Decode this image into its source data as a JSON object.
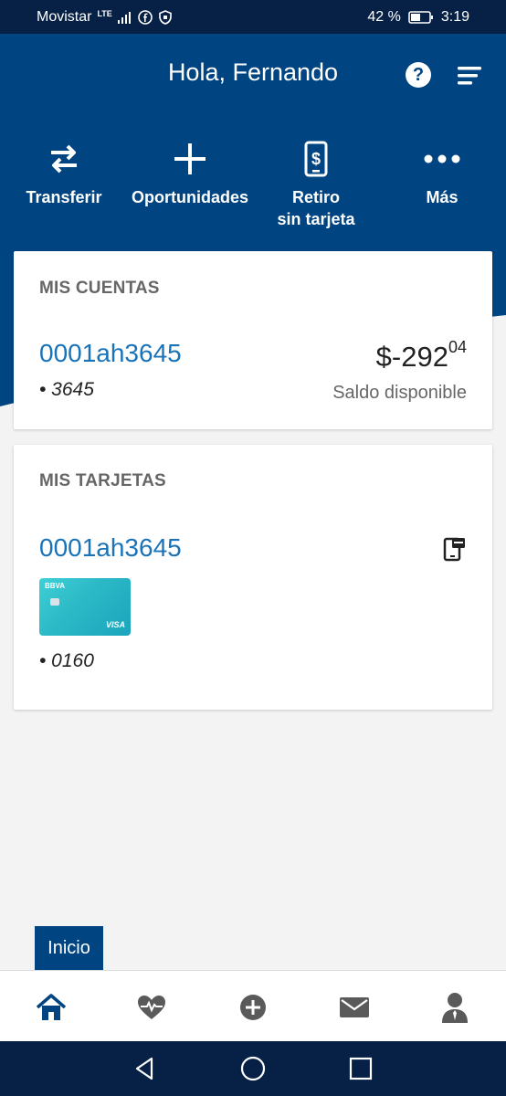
{
  "status_bar": {
    "carrier": "Movistar",
    "network": "LTE",
    "battery": "42 %",
    "time": "3:19"
  },
  "header": {
    "greeting": "Hola, Fernando",
    "help_icon": "question-circle-icon",
    "menu_icon": "menu-lines-icon"
  },
  "quick_actions": [
    {
      "label": "Transferir",
      "icon": "transfer-arrows-icon"
    },
    {
      "label": "Oportunidades",
      "icon": "plus-icon"
    },
    {
      "label_line1": "Retiro",
      "label_line2": "sin tarjeta",
      "icon": "phone-dollar-icon"
    },
    {
      "label": "Más",
      "icon": "more-dots-icon"
    }
  ],
  "accounts": {
    "title": "MIS CUENTAS",
    "name": "0001ah3645",
    "number": "• 3645",
    "balance_main": "$-292",
    "balance_cents": "04",
    "balance_label": "Saldo disponible"
  },
  "cards": {
    "title": "MIS TARJETAS",
    "name": "0001ah3645",
    "number": "• 0160",
    "card_brand": "BBVA",
    "card_network": "VISA",
    "card_icon": "mobile-card-icon"
  },
  "tab_label": "Inicio",
  "bottom_nav": [
    "home-icon",
    "health-heart-icon",
    "add-circle-icon",
    "mail-icon",
    "profile-icon"
  ],
  "colors": {
    "primary": "#004481",
    "status_bar": "#072146",
    "link": "#1973b8",
    "background": "#f3f3f3"
  }
}
